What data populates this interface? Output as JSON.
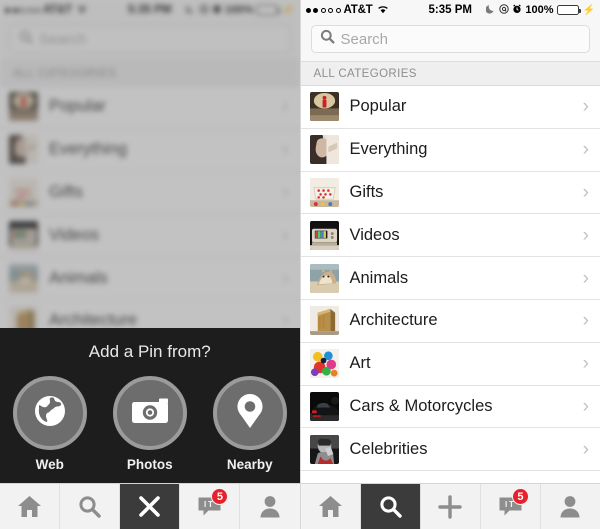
{
  "statusbar": {
    "signal_dots_filled": 2,
    "signal_dots_total": 5,
    "carrier": "AT&T",
    "wifi_icon": "wifi-icon",
    "time": "5:35 PM",
    "moon_icon": "moon-icon",
    "location_icon": "location-icon",
    "alarm_icon": "alarm-icon",
    "battery_percent": "100%",
    "battery_color": "#4cd964",
    "charging_icon": "lightning-bolt-icon"
  },
  "search": {
    "placeholder": "Search",
    "icon": "search-icon",
    "value": ""
  },
  "section": {
    "header": "ALL CATEGORIES"
  },
  "categories": [
    {
      "label": "Popular",
      "thumb": "red-figure-on-road-photo",
      "chevron": "›"
    },
    {
      "label": "Everything",
      "thumb": "person-hand-photo",
      "chevron": "›"
    },
    {
      "label": "Gifts",
      "thumb": "polka-dot-gift-box-photo",
      "chevron": "›"
    },
    {
      "label": "Videos",
      "thumb": "retro-tv-photo",
      "chevron": "›"
    },
    {
      "label": "Animals",
      "thumb": "cat-photo",
      "chevron": "›"
    },
    {
      "label": "Architecture",
      "thumb": "modern-building-photo",
      "chevron": "›"
    },
    {
      "label": "Art",
      "thumb": "colorful-paint-art-photo",
      "chevron": "›"
    },
    {
      "label": "Cars & Motorcycles",
      "thumb": "black-sports-car-photo",
      "chevron": "›"
    },
    {
      "label": "Celebrities",
      "thumb": "man-portrait-bw-photo",
      "chevron": "›"
    }
  ],
  "tabbar_right": {
    "items": [
      {
        "name": "home",
        "icon": "home-icon",
        "active": false,
        "badge": ""
      },
      {
        "name": "search",
        "icon": "search-icon",
        "active": true,
        "badge": ""
      },
      {
        "name": "add",
        "icon": "plus-icon",
        "active": false,
        "badge": ""
      },
      {
        "name": "messages",
        "icon": "chat-icon",
        "active": false,
        "badge": "5"
      },
      {
        "name": "profile",
        "icon": "person-icon",
        "active": false,
        "badge": ""
      }
    ]
  },
  "tabbar_left": {
    "items": [
      {
        "name": "home",
        "icon": "home-icon",
        "active": false,
        "badge": ""
      },
      {
        "name": "search",
        "icon": "search-icon",
        "active": false,
        "badge": ""
      },
      {
        "name": "close",
        "icon": "close-x-icon",
        "active": true,
        "badge": ""
      },
      {
        "name": "messages",
        "icon": "chat-icon",
        "active": false,
        "badge": "5"
      },
      {
        "name": "profile",
        "icon": "person-icon",
        "active": false,
        "badge": ""
      }
    ]
  },
  "pin_sheet": {
    "title": "Add a Pin from?",
    "options": [
      {
        "label": "Web",
        "icon": "globe-icon"
      },
      {
        "label": "Photos",
        "icon": "camera-icon"
      },
      {
        "label": "Nearby",
        "icon": "map-pin-icon"
      }
    ],
    "background_color": "#1d1d1d",
    "badge_color": "#e8202a"
  }
}
